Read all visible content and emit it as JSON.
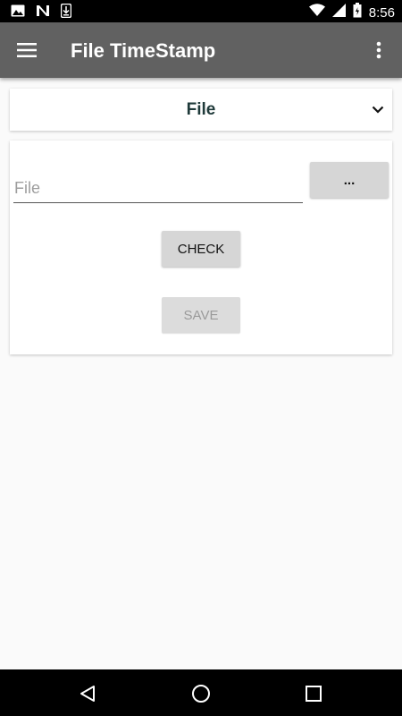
{
  "status_bar": {
    "time": "8:56",
    "icons": [
      "image-icon",
      "n-icon",
      "download-icon",
      "wifi-icon",
      "signal-icon",
      "battery-icon"
    ]
  },
  "app_bar": {
    "title": "File TimeStamp",
    "menu_icon": "hamburger-menu-icon",
    "overflow_icon": "more-vert-icon",
    "background": "#616161"
  },
  "selector": {
    "value": "File",
    "icon": "chevron-down-icon"
  },
  "form": {
    "file_input": {
      "value": "",
      "placeholder": "File"
    },
    "browse_label": "...",
    "check_label": "CHECK",
    "save_label": "SAVE",
    "save_disabled": true
  },
  "nav_bar": {
    "icons": [
      "back-icon",
      "home-icon",
      "recents-icon"
    ]
  }
}
